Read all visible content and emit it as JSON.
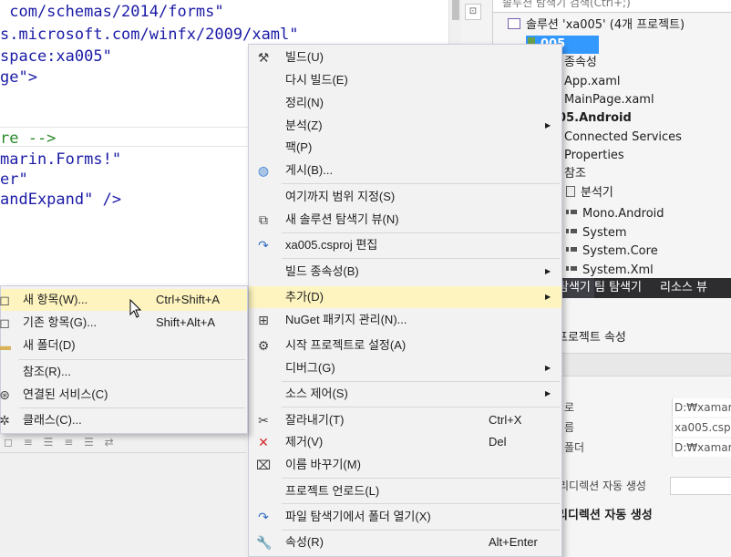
{
  "editor": {
    "lines": [
      {
        "text": " com/schemas/2014/forms\"",
        "color": "blue"
      },
      {
        "text": "s.microsoft.com/winfx/2009/xaml\"",
        "color": "blue"
      },
      {
        "text": "space:xa005\"",
        "color": "blue"
      },
      {
        "text": "ge\">",
        "color": "blue"
      },
      {
        "text": "",
        "color": "dark"
      },
      {
        "text": "",
        "color": "dark"
      },
      {
        "text": "re -->",
        "color": "green"
      },
      {
        "text": "marin.Forms!\"",
        "color": "blue"
      },
      {
        "text": "er\"",
        "color": "blue"
      },
      {
        "text": "andExpand\" />",
        "color": "blue"
      }
    ]
  },
  "solution_explorer": {
    "search_text": "솔루션 탐색기 검색(Ctrl+;)",
    "items": [
      {
        "label": "솔루션 'xa005' (4개 프로젝트)",
        "icon": "solution-icon",
        "bold": false,
        "selected": false
      },
      {
        "label": "005",
        "icon": "project-icon",
        "bold": true,
        "selected": true
      },
      {
        "label": "종속성",
        "icon": "dependencies-icon",
        "bold": false,
        "selected": false
      },
      {
        "label": "App.xaml",
        "icon": "xaml-file-icon",
        "bold": false,
        "selected": false
      },
      {
        "label": "MainPage.xaml",
        "icon": "xaml-file-icon",
        "bold": false,
        "selected": false
      },
      {
        "label": "005.Android",
        "icon": "project-icon",
        "bold": true,
        "selected": false
      },
      {
        "label": "Connected Services",
        "icon": "connected-services-icon",
        "bold": false,
        "selected": false
      },
      {
        "label": "Properties",
        "icon": "properties-icon",
        "bold": false,
        "selected": false
      },
      {
        "label": "참조",
        "icon": "references-icon",
        "bold": false,
        "selected": false
      },
      {
        "label": "분석기",
        "icon": "analyzer-icon",
        "bold": false,
        "selected": false
      },
      {
        "label": "Mono.Android",
        "icon": "reference-icon",
        "bold": false,
        "selected": false
      },
      {
        "label": "System",
        "icon": "reference-icon",
        "bold": false,
        "selected": false
      },
      {
        "label": "System.Core",
        "icon": "reference-icon",
        "bold": false,
        "selected": false
      },
      {
        "label": "System.Xml",
        "icon": "reference-icon",
        "bold": false,
        "selected": false
      }
    ]
  },
  "bottom_tabs": [
    "탐색기",
    "팀 탐색기",
    "리소스 뷰"
  ],
  "properties": {
    "title": "프로젝트 속성",
    "rows": [
      {
        "name": "로",
        "value": "D:₩xamarin"
      },
      {
        "name": "름",
        "value": "xa005.csproj"
      },
      {
        "name": "폴더",
        "value": "D:₩xamarin"
      },
      {
        "name": "리디렉션 자동 생성",
        "value": ""
      }
    ],
    "description_title": "리디렉션 자동 생성"
  },
  "context_menu": {
    "items": [
      {
        "label": "빌드(U)",
        "icon": "build-icon",
        "shortcut": "",
        "submenu": false
      },
      {
        "label": "다시 빌드(E)",
        "icon": "",
        "shortcut": "",
        "submenu": false
      },
      {
        "label": "정리(N)",
        "icon": "",
        "shortcut": "",
        "submenu": false
      },
      {
        "label": "분석(Z)",
        "icon": "",
        "shortcut": "",
        "submenu": true
      },
      {
        "label": "팩(P)",
        "icon": "",
        "shortcut": "",
        "submenu": false
      },
      {
        "label": "게시(B)...",
        "icon": "globe-icon",
        "shortcut": "",
        "submenu": false
      },
      {
        "label": "여기까지 범위 지정(S)",
        "icon": "",
        "shortcut": "",
        "submenu": false
      },
      {
        "label": "새 솔루션 탐색기 뷰(N)",
        "icon": "new-view-icon",
        "shortcut": "",
        "submenu": false
      },
      {
        "label": "xa005.csproj 편집",
        "icon": "refresh-arrow-icon",
        "shortcut": "",
        "submenu": false
      },
      {
        "label": "빌드 종속성(B)",
        "icon": "",
        "shortcut": "",
        "submenu": true
      },
      {
        "label": "추가(D)",
        "icon": "",
        "shortcut": "",
        "submenu": true,
        "highlighted": true
      },
      {
        "label": "NuGet 패키지 관리(N)...",
        "icon": "nuget-icon",
        "shortcut": "",
        "submenu": false
      },
      {
        "label": "시작 프로젝트로 설정(A)",
        "icon": "gear-icon",
        "shortcut": "",
        "submenu": false
      },
      {
        "label": "디버그(G)",
        "icon": "",
        "shortcut": "",
        "submenu": true
      },
      {
        "label": "소스 제어(S)",
        "icon": "",
        "shortcut": "",
        "submenu": true
      },
      {
        "label": "잘라내기(T)",
        "icon": "scissors-icon",
        "shortcut": "Ctrl+X",
        "submenu": false
      },
      {
        "label": "제거(V)",
        "icon": "red-x-icon",
        "shortcut": "Del",
        "submenu": false
      },
      {
        "label": "이름 바꾸기(M)",
        "icon": "rename-icon",
        "shortcut": "",
        "submenu": false
      },
      {
        "label": "프로젝트 언로드(L)",
        "icon": "",
        "shortcut": "",
        "submenu": false
      },
      {
        "label": "파일 탐색기에서 폴더 열기(X)",
        "icon": "refresh-arrow-icon",
        "shortcut": "",
        "submenu": false
      },
      {
        "label": "속성(R)",
        "icon": "wrench-icon",
        "shortcut": "Alt+Enter",
        "submenu": false
      }
    ]
  },
  "submenu": {
    "items": [
      {
        "label": "새 항목(W)...",
        "icon": "new-item-icon",
        "shortcut": "Ctrl+Shift+A",
        "highlighted": true
      },
      {
        "label": "기존 항목(G)...",
        "icon": "existing-item-icon",
        "shortcut": "Shift+Alt+A"
      },
      {
        "label": "새 폴더(D)",
        "icon": "folder-icon",
        "shortcut": ""
      },
      {
        "label": "참조(R)...",
        "icon": "",
        "shortcut": ""
      },
      {
        "label": "연결된 서비스(C)",
        "icon": "connected-services-icon",
        "shortcut": ""
      },
      {
        "label": "클래스(C)...",
        "icon": "class-icon",
        "shortcut": ""
      }
    ]
  },
  "colors": {
    "menu_highlight": "#fdf4bf",
    "selection": "#3399ff",
    "code_blue": "#1a1aa6",
    "code_green": "#2a8a2a",
    "remove_red": "#d42a2a"
  }
}
